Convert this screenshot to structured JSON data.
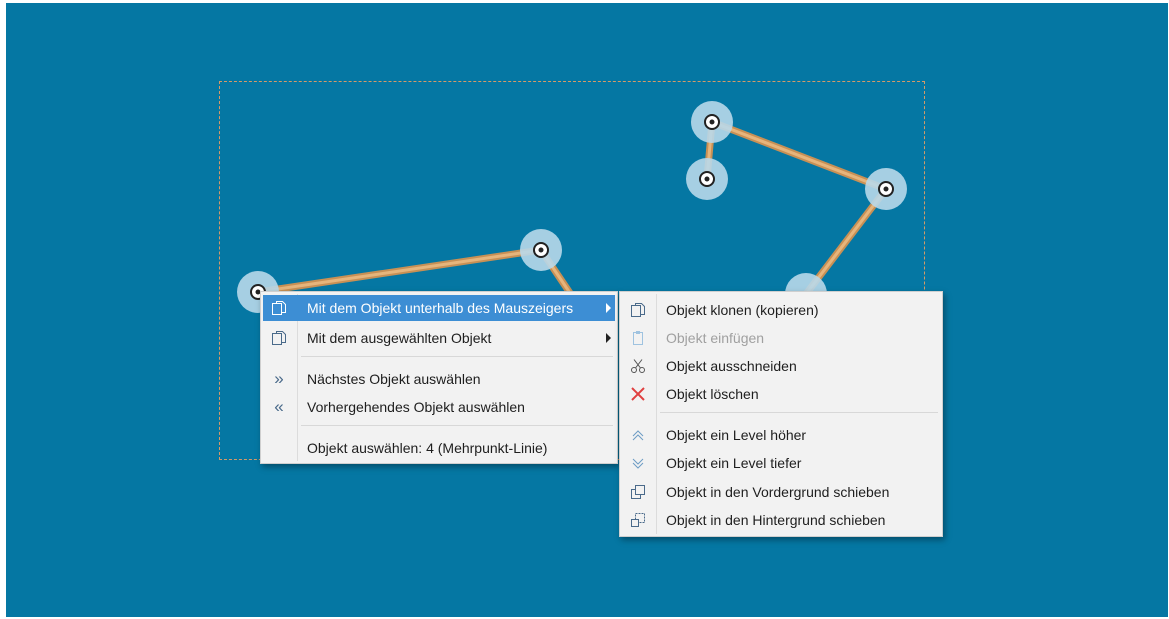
{
  "colors": {
    "canvas": "#0577a3",
    "selection_border": "#d59a67",
    "line": "#d8a56b",
    "node_halo": "#b8d8ea",
    "menu_bg": "#f2f2f2",
    "highlight": "#3d8ed4",
    "delete_icon": "#e04040"
  },
  "context_menu": {
    "items": [
      {
        "icon": "clone-icon",
        "label": "Mit dem Objekt unterhalb des Mauszeigers",
        "has_submenu": true,
        "highlighted": true
      },
      {
        "icon": "clone-icon",
        "label": "Mit dem ausgewählten Objekt",
        "has_submenu": true
      },
      {
        "icon": "double-chevron-right-icon",
        "label": "Nächstes Objekt auswählen"
      },
      {
        "icon": "double-chevron-left-icon",
        "label": "Vorhergehendes Objekt auswählen"
      },
      {
        "icon": "",
        "label": "Objekt auswählen: 4 (Mehrpunkt-Linie)"
      }
    ]
  },
  "submenu": {
    "items": [
      {
        "icon": "clone-icon",
        "label": "Objekt klonen (kopieren)"
      },
      {
        "icon": "paste-icon",
        "label": "Objekt einfügen",
        "disabled": true
      },
      {
        "icon": "scissors-icon",
        "label": "Objekt ausschneiden"
      },
      {
        "icon": "delete-x-icon",
        "label": "Objekt löschen"
      },
      {
        "icon": "chevron-up-icon",
        "label": "Objekt ein Level höher"
      },
      {
        "icon": "chevron-down-icon",
        "label": "Objekt ein Level tiefer"
      },
      {
        "icon": "bring-to-front-icon",
        "label": "Objekt in den Vordergrund schieben"
      },
      {
        "icon": "send-to-back-icon",
        "label": "Objekt in den Hintergrund schieben"
      }
    ]
  }
}
